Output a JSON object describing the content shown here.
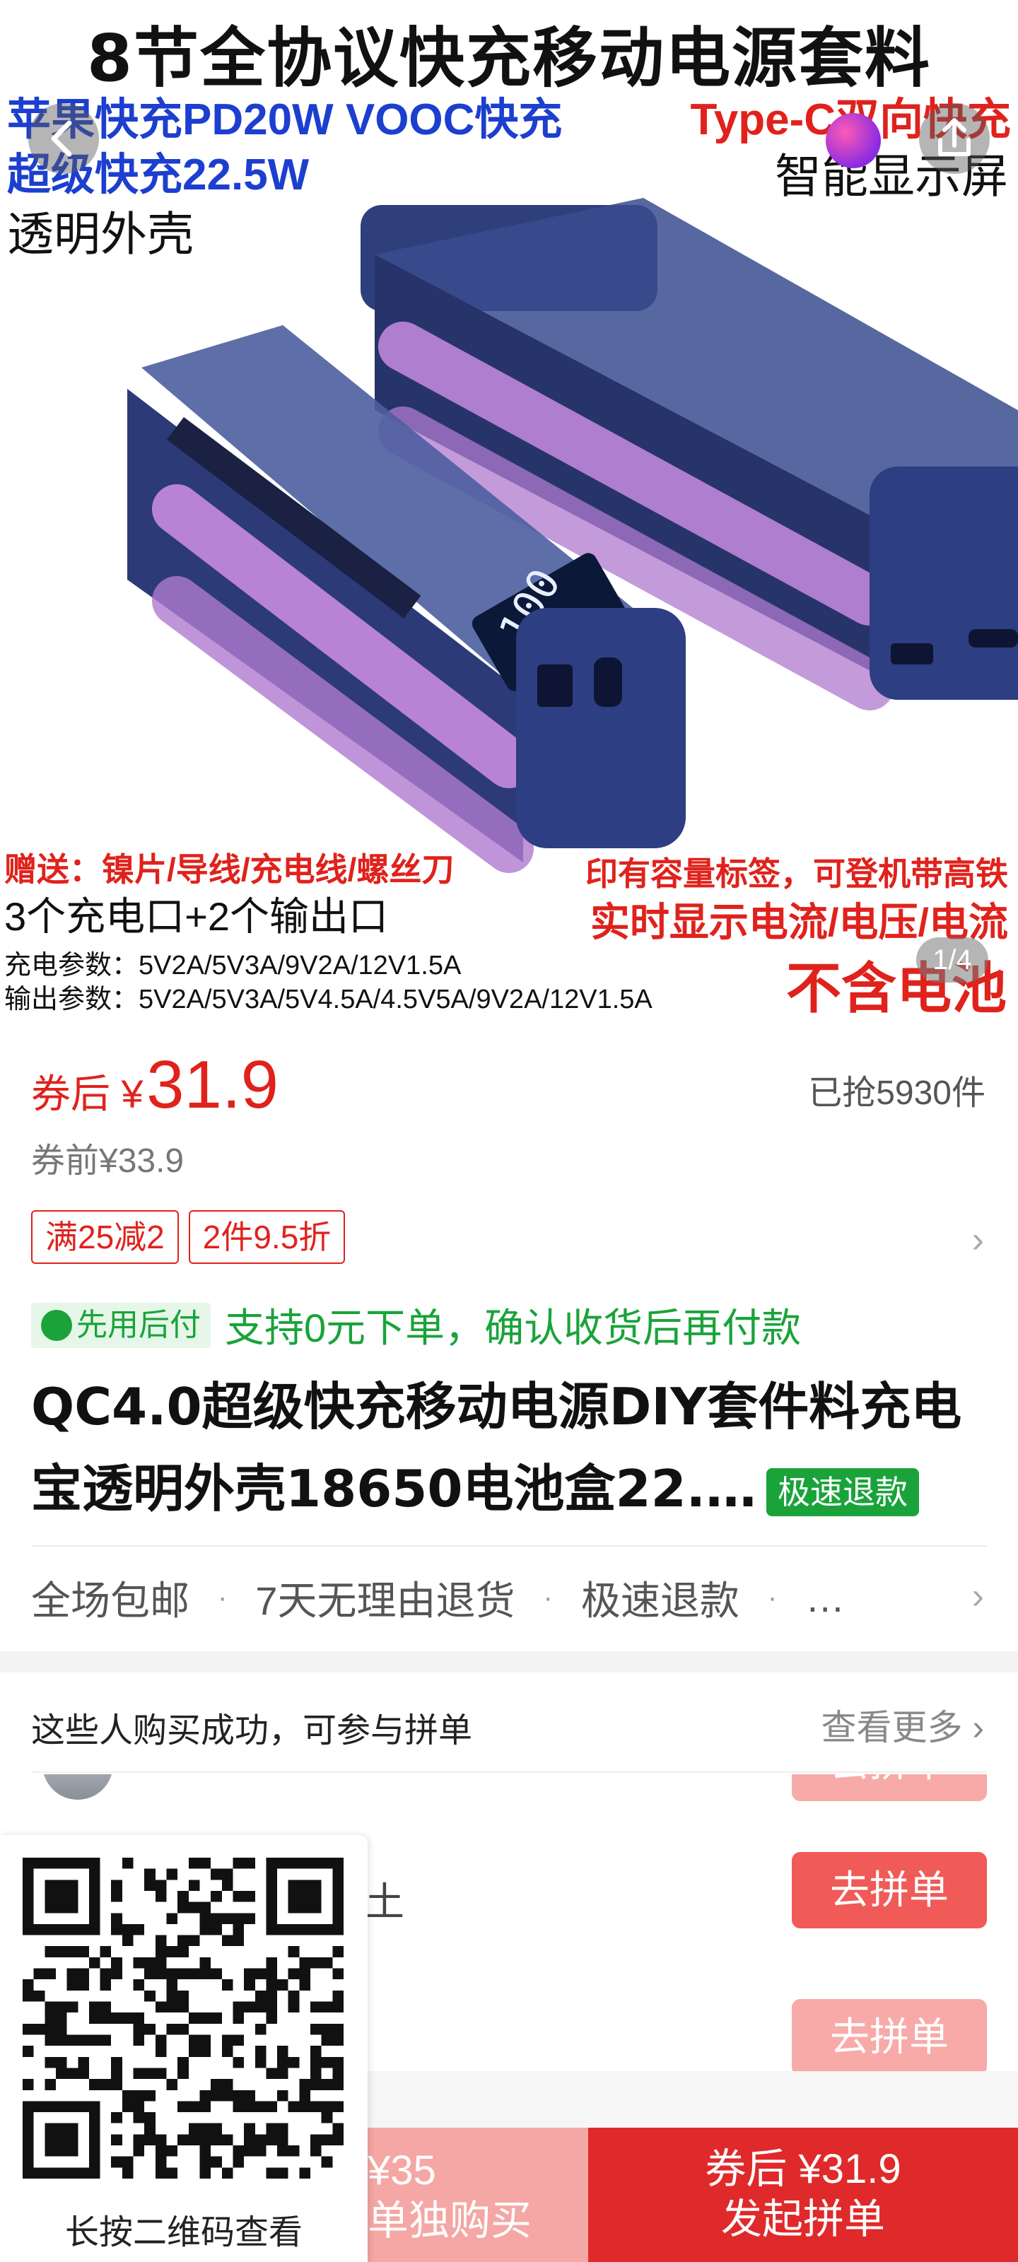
{
  "gallery": {
    "title": "8节全协议快充移动电源套料",
    "line_blue_1": "苹果快充PD20W  VOOC快充",
    "line_blue_2": "超级快充22.5W",
    "line_red_1": "Type-C双向快充",
    "line_black_1": "智能显示屏",
    "line_black_2": "透明外壳",
    "gift_text": "赠送：镍片/导线/充电线/螺丝刀",
    "label_text": "印有容量标签，可登机带高铁",
    "ports_text": "3个充电口+2个输出口",
    "display_text": "实时显示电流/电压/电流",
    "charge_params": "充电参数：5V2A/5V3A/9V2A/12V1.5A",
    "output_params": "输出参数：5V2A/5V3A/5V4.5A/4.5V5A/9V2A/12V1.5A",
    "no_battery": "不含电池",
    "pager": "1/4",
    "icons": {
      "back": "chevron-left-icon",
      "share": "share-icon"
    }
  },
  "price": {
    "label": "券后 ¥",
    "value": "31.9",
    "sold": "已抢5930件",
    "original": "券前¥33.9"
  },
  "promos": [
    "满25减2",
    "2件9.5折"
  ],
  "pay": {
    "badge": "先用后付",
    "text": "支持0元下单，确认收货后再付款"
  },
  "product": {
    "title": "QC4.0超级快充移动电源DIY套件料充电宝透明外壳18650电池盒22.…",
    "badge": "极速退款"
  },
  "services": [
    "全场包邮",
    "7天无理由退货",
    "极速退款",
    "…"
  ],
  "group": {
    "title": "这些人购买成功，可参与拼单",
    "more": "查看更多",
    "join_label": "去拼单",
    "visible_name_fragment": "土"
  },
  "bottom": {
    "solo_price": "¥35",
    "solo_label": "单独购买",
    "group_price": "券后 ¥31.9",
    "group_label": "发起拼单"
  },
  "qr": {
    "caption": "长按二维码查看"
  },
  "colors": {
    "accent_red": "#e0221c",
    "green": "#1aa33a",
    "blue": "#1c3fcf"
  }
}
